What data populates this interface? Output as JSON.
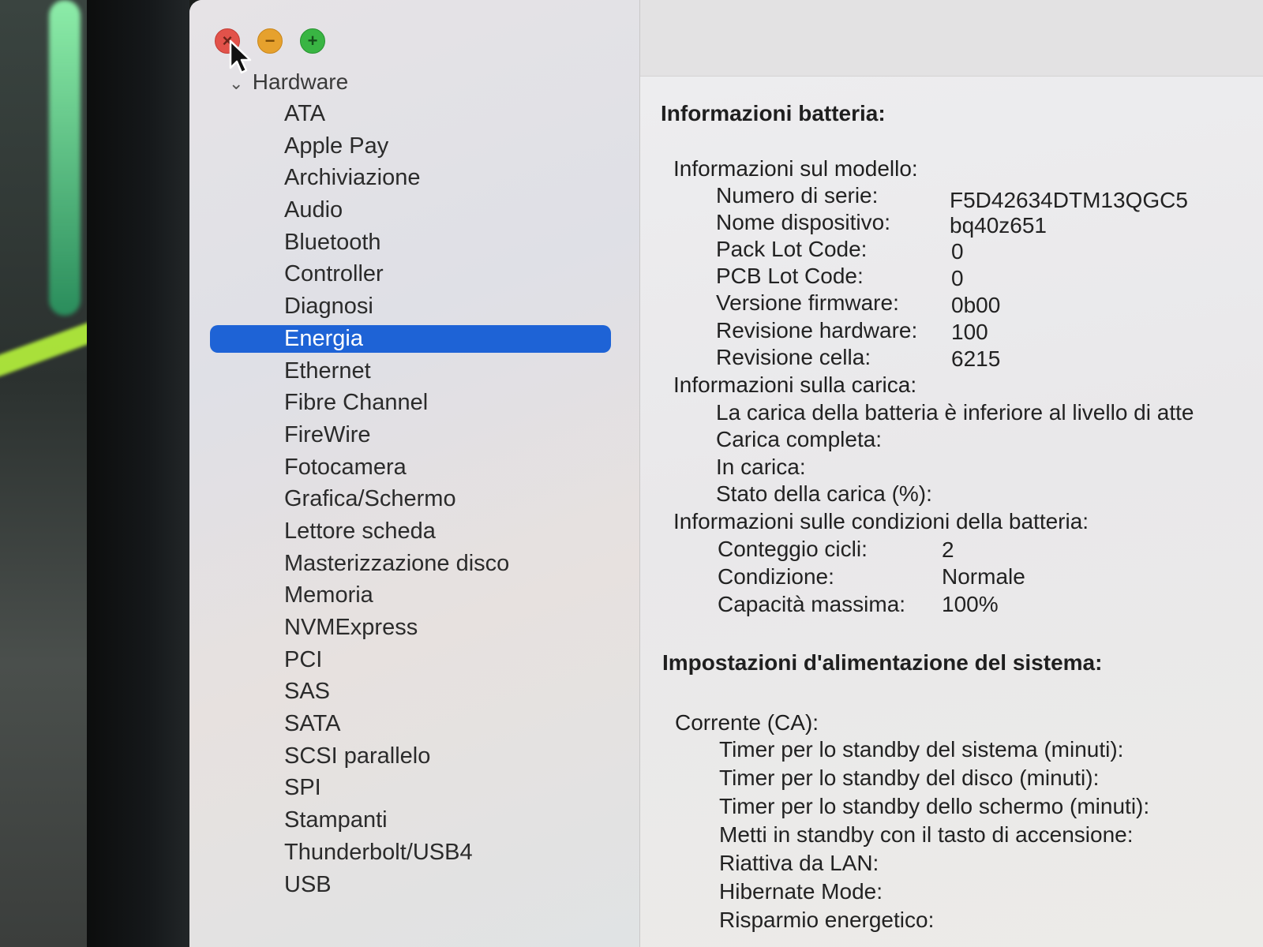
{
  "window": {
    "controls": {
      "close": "×",
      "minimize": "−",
      "maximize": "+"
    }
  },
  "sidebar": {
    "section_title": "Hardware",
    "items": [
      {
        "label": "ATA"
      },
      {
        "label": "Apple Pay"
      },
      {
        "label": "Archiviazione"
      },
      {
        "label": "Audio"
      },
      {
        "label": "Bluetooth"
      },
      {
        "label": "Controller"
      },
      {
        "label": "Diagnosi"
      },
      {
        "label": "Energia",
        "selected": true
      },
      {
        "label": "Ethernet"
      },
      {
        "label": "Fibre Channel"
      },
      {
        "label": "FireWire"
      },
      {
        "label": "Fotocamera"
      },
      {
        "label": "Grafica/Schermo"
      },
      {
        "label": "Lettore scheda"
      },
      {
        "label": "Masterizzazione disco"
      },
      {
        "label": "Memoria"
      },
      {
        "label": "NVMExpress"
      },
      {
        "label": "PCI"
      },
      {
        "label": "SAS"
      },
      {
        "label": "SATA"
      },
      {
        "label": "SCSI parallelo"
      },
      {
        "label": "SPI"
      },
      {
        "label": "Stampanti"
      },
      {
        "label": "Thunderbolt/USB4"
      },
      {
        "label": "USB"
      }
    ]
  },
  "battery": {
    "title": "Informazioni batteria:",
    "model": {
      "title": "Informazioni sul modello:",
      "serial_label": "Numero di serie:",
      "serial_value": "F5D42634DTM13QGC5",
      "device_label": "Nome dispositivo:",
      "device_value": "bq40z651",
      "pack_label": "Pack Lot Code:",
      "pack_value": "0",
      "pcb_label": "PCB Lot Code:",
      "pcb_value": "0",
      "firmware_label": "Versione firmware:",
      "firmware_value": "0b00",
      "hw_label": "Revisione hardware:",
      "hw_value": "100",
      "cell_label": "Revisione cella:",
      "cell_value": "6215"
    },
    "charge": {
      "title": "Informazioni sulla carica:",
      "below_warning": "La carica della batteria è inferiore al livello di atte",
      "complete_label": "Carica completa:",
      "charging_label": "In carica:",
      "state_label": "Stato della carica (%):"
    },
    "health": {
      "title": "Informazioni sulle condizioni della batteria:",
      "cycles_label": "Conteggio cicli:",
      "cycles_value": "2",
      "condition_label": "Condizione:",
      "condition_value": "Normale",
      "capacity_label": "Capacità massima:",
      "capacity_value": "100%"
    }
  },
  "power": {
    "title": "Impostazioni d'alimentazione del sistema:",
    "ac": {
      "title": "Corrente (CA):",
      "items": [
        "Timer per lo standby del sistema (minuti):",
        "Timer per lo standby del disco (minuti):",
        "Timer per lo standby dello schermo (minuti):",
        "Metti in standby con il tasto di accensione:",
        "Riattiva da LAN:",
        "Hibernate Mode:",
        "Risparmio energetico:"
      ]
    }
  }
}
